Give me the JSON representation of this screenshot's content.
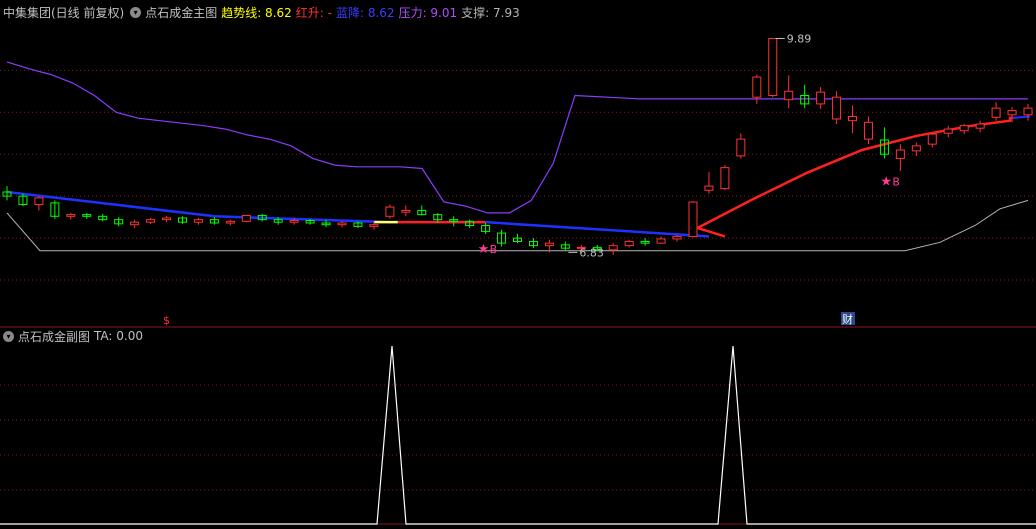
{
  "main_header": {
    "stock": "中集集团(日线 前复权)",
    "indicator": "点石成金主图",
    "trend_label": "趋势线: 8.62",
    "red_label": "红升: -",
    "blue_label": "蓝降: 8.62",
    "pressure_label": "压力: 9.01",
    "support_label": "支撑: 7.93"
  },
  "sub_header": {
    "indicator": "点石成金副图",
    "ta_label": "TA: 0.00"
  },
  "colors": {
    "up": "#ff3232",
    "down": "#00ff00",
    "trend_up": "#ff2020",
    "trend_down": "#1e32ff",
    "pressure": "#8a3cff",
    "support": "#b4b4b4",
    "grid": "#8b1a1a",
    "signal": "#ffffff",
    "star": "#ff3c96"
  },
  "chart_data": [
    {
      "type": "candlestick",
      "title": "点石成金主图",
      "ylim": [
        6.5,
        10.1
      ],
      "x": [
        "1",
        "2",
        "3",
        "4",
        "5",
        "6",
        "7",
        "8",
        "9",
        "10",
        "11",
        "12",
        "13",
        "14",
        "15",
        "16",
        "17",
        "18",
        "19",
        "20",
        "21",
        "22",
        "23",
        "24",
        "25",
        "26",
        "27",
        "28",
        "29",
        "30",
        "31",
        "32",
        "33",
        "34",
        "35",
        "36",
        "37",
        "38",
        "39",
        "40",
        "40b",
        "41",
        "42",
        "43",
        "44",
        "45",
        "46",
        "47",
        "48",
        "49",
        "50",
        "51",
        "52",
        "53",
        "54",
        "55",
        "56",
        "57",
        "58",
        "59",
        "60",
        "61",
        "62",
        "63",
        "64",
        "65",
        "66",
        "67",
        "68",
        "69"
      ],
      "ohlc": [
        [
          8.05,
          8.12,
          7.95,
          8.0
        ],
        [
          8.0,
          8.03,
          7.88,
          7.9
        ],
        [
          7.9,
          8.0,
          7.83,
          7.98
        ],
        [
          7.92,
          7.95,
          7.73,
          7.76
        ],
        [
          7.76,
          7.8,
          7.72,
          7.78
        ],
        [
          7.78,
          7.8,
          7.73,
          7.76
        ],
        [
          7.76,
          7.79,
          7.7,
          7.72
        ],
        [
          7.72,
          7.75,
          7.64,
          7.67
        ],
        [
          7.66,
          7.72,
          7.62,
          7.69
        ],
        [
          7.69,
          7.74,
          7.67,
          7.72
        ],
        [
          7.72,
          7.76,
          7.69,
          7.74
        ],
        [
          7.74,
          7.76,
          7.67,
          7.69
        ],
        [
          7.69,
          7.74,
          7.66,
          7.72
        ],
        [
          7.72,
          7.75,
          7.66,
          7.68
        ],
        [
          7.68,
          7.72,
          7.65,
          7.7
        ],
        [
          7.7,
          7.78,
          7.69,
          7.77
        ],
        [
          7.77,
          7.79,
          7.7,
          7.72
        ],
        [
          7.72,
          7.75,
          7.66,
          7.69
        ],
        [
          7.69,
          7.74,
          7.66,
          7.71
        ],
        [
          7.71,
          7.73,
          7.66,
          7.68
        ],
        [
          7.68,
          7.72,
          7.63,
          7.66
        ],
        [
          7.66,
          7.7,
          7.63,
          7.68
        ],
        [
          7.68,
          7.7,
          7.62,
          7.64
        ],
        [
          7.64,
          7.7,
          7.6,
          7.66
        ],
        [
          7.76,
          7.9,
          7.73,
          7.87
        ],
        [
          7.81,
          7.89,
          7.76,
          7.83
        ],
        [
          7.83,
          7.89,
          7.77,
          7.78
        ],
        [
          7.78,
          7.8,
          7.68,
          7.72
        ],
        [
          7.72,
          7.76,
          7.64,
          7.7
        ],
        [
          7.7,
          7.72,
          7.62,
          7.65
        ],
        [
          7.65,
          7.68,
          7.55,
          7.58
        ],
        [
          7.56,
          7.6,
          7.4,
          7.44
        ],
        [
          7.5,
          7.55,
          7.44,
          7.46
        ],
        [
          7.46,
          7.5,
          7.38,
          7.41
        ],
        [
          7.41,
          7.48,
          7.33,
          7.44
        ],
        [
          7.42,
          7.46,
          7.35,
          7.38
        ],
        [
          7.38,
          7.42,
          7.35,
          7.39
        ],
        [
          7.39,
          7.42,
          7.34,
          7.36
        ],
        [
          7.36,
          7.44,
          7.3,
          7.41
        ],
        [
          7.41,
          7.48,
          7.39,
          7.46
        ],
        [
          7.46,
          7.5,
          7.41,
          7.44
        ],
        [
          7.44,
          7.52,
          7.43,
          7.49
        ],
        [
          7.49,
          7.54,
          7.46,
          7.52
        ],
        [
          7.52,
          7.94,
          7.51,
          7.93
        ],
        [
          8.07,
          8.29,
          8.03,
          8.12
        ],
        [
          8.09,
          8.37,
          8.07,
          8.34
        ],
        [
          8.48,
          8.75,
          8.45,
          8.68
        ],
        [
          9.18,
          9.45,
          9.1,
          9.42
        ],
        [
          9.2,
          9.88,
          9.18,
          9.88
        ],
        [
          9.15,
          9.44,
          9.05,
          9.25
        ],
        [
          9.2,
          9.33,
          9.05,
          9.1
        ],
        [
          9.1,
          9.3,
          9.04,
          9.24
        ],
        [
          8.92,
          9.25,
          8.86,
          9.18
        ],
        [
          8.9,
          9.08,
          8.75,
          8.95
        ],
        [
          8.68,
          8.95,
          8.62,
          8.88
        ],
        [
          8.67,
          8.82,
          8.45,
          8.5
        ],
        [
          8.45,
          8.62,
          8.3,
          8.55
        ],
        [
          8.54,
          8.64,
          8.48,
          8.6
        ],
        [
          8.62,
          8.75,
          8.58,
          8.74
        ],
        [
          8.75,
          8.84,
          8.7,
          8.8
        ],
        [
          8.78,
          8.86,
          8.74,
          8.84
        ],
        [
          8.81,
          8.9,
          8.76,
          8.86
        ],
        [
          8.94,
          9.12,
          8.9,
          9.05
        ],
        [
          8.97,
          9.06,
          8.88,
          9.02
        ],
        [
          8.97,
          9.1,
          8.9,
          9.05
        ]
      ],
      "trend_line": {
        "red_segments": [
          [
            24,
            7.69
          ],
          [
            30,
            7.69
          ],
          [
            45,
            7.52
          ],
          [
            48,
            7.62
          ],
          [
            52,
            7.96
          ],
          [
            56,
            8.28
          ],
          [
            60,
            8.55
          ],
          [
            64,
            8.72
          ],
          [
            68,
            8.84
          ],
          [
            72,
            8.9
          ],
          [
            76,
            8.95
          ]
        ],
        "blue_segments": [
          [
            0,
            8.05
          ],
          [
            13,
            7.76
          ],
          [
            24,
            7.69
          ],
          [
            30,
            7.69
          ],
          [
            44,
            7.52
          ],
          [
            76,
            8.96
          ]
        ]
      },
      "pressure": [
        9.6,
        9.52,
        9.45,
        9.35,
        9.2,
        9.0,
        8.93,
        8.9,
        8.87,
        8.84,
        8.8,
        8.73,
        8.68,
        8.6,
        8.45,
        8.37,
        8.35,
        8.35,
        8.35,
        8.33,
        7.93,
        7.88,
        7.8,
        7.8,
        7.95,
        8.39,
        9.2,
        9.16,
        9.16,
        9.16,
        9.16,
        9.16,
        9.16,
        9.16
      ],
      "support": [
        7.8,
        7.35,
        7.35,
        7.35,
        7.35,
        7.35,
        7.45,
        7.65,
        7.85,
        7.95
      ],
      "annotations": [
        "9.89",
        "6.83",
        "B",
        "B",
        "$",
        "财"
      ]
    },
    {
      "type": "line",
      "title": "点石成金副图",
      "series": [
        {
          "name": "TA",
          "values": [
            0,
            1,
            0,
            1,
            0
          ]
        }
      ]
    }
  ]
}
